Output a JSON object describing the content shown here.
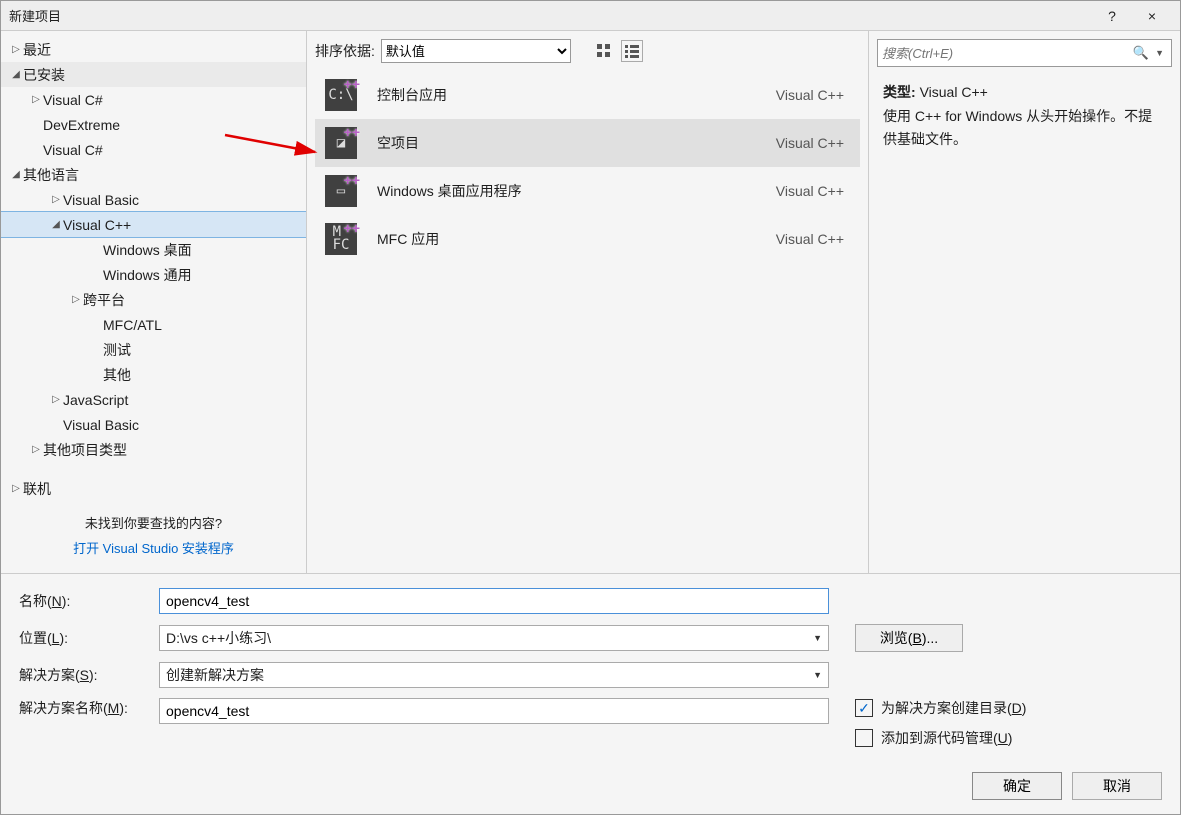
{
  "window": {
    "title": "新建项目",
    "help": "?",
    "close": "×"
  },
  "sidebar": {
    "recent": "最近",
    "installed": "已安装",
    "items": [
      {
        "label": "Visual C#",
        "indent": 1,
        "arrow": "▷"
      },
      {
        "label": "DevExtreme",
        "indent": 1,
        "arrow": ""
      },
      {
        "label": "Visual C#",
        "indent": 1,
        "arrow": ""
      },
      {
        "label": "其他语言",
        "indent": 1,
        "arrow": "◢",
        "section": true,
        "indentOverride": 0
      },
      {
        "label": "Visual Basic",
        "indent": 2,
        "arrow": "▷"
      },
      {
        "label": "Visual C++",
        "indent": 2,
        "arrow": "◢",
        "selected": true
      },
      {
        "label": "Windows 桌面",
        "indent": 4,
        "arrow": ""
      },
      {
        "label": "Windows 通用",
        "indent": 4,
        "arrow": ""
      },
      {
        "label": "跨平台",
        "indent": 3,
        "arrow": "▷"
      },
      {
        "label": "MFC/ATL",
        "indent": 4,
        "arrow": ""
      },
      {
        "label": "测试",
        "indent": 4,
        "arrow": ""
      },
      {
        "label": "其他",
        "indent": 4,
        "arrow": ""
      },
      {
        "label": "JavaScript",
        "indent": 2,
        "arrow": "▷"
      },
      {
        "label": "Visual Basic",
        "indent": 2,
        "arrow": ""
      },
      {
        "label": "其他项目类型",
        "indent": 1,
        "arrow": "▷"
      }
    ],
    "online": "联机",
    "footer1": "未找到你要查找的内容?",
    "footer2": "打开 Visual Studio 安装程序"
  },
  "toolbar": {
    "sort_label": "排序依据:",
    "sort_value": "默认值"
  },
  "templates": [
    {
      "name": "控制台应用",
      "lang": "Visual C++",
      "sym": "C:\\"
    },
    {
      "name": "空项目",
      "lang": "Visual C++",
      "sym": "◪",
      "selected": true
    },
    {
      "name": "Windows 桌面应用程序",
      "lang": "Visual C++",
      "sym": "▭"
    },
    {
      "name": "MFC 应用",
      "lang": "Visual C++",
      "sym": "M\nFC"
    }
  ],
  "search": {
    "placeholder": "搜索(Ctrl+E)"
  },
  "desc": {
    "type_label": "类型:",
    "type_value": "Visual C++",
    "text": "使用 C++ for Windows 从头开始操作。不提供基础文件。"
  },
  "form": {
    "name_label": "名称(N):",
    "name_value": "opencv4_test",
    "loc_label": "位置(L):",
    "loc_value": "D:\\vs c++小练习\\",
    "browse_label": "浏览(B)...",
    "sln_label": "解决方案(S):",
    "sln_value": "创建新解决方案",
    "slnname_label": "解决方案名称(M):",
    "slnname_value": "opencv4_test",
    "chk1": "为解决方案创建目录(D)",
    "chk2": "添加到源代码管理(U)"
  },
  "buttons": {
    "ok": "确定",
    "cancel": "取消"
  }
}
